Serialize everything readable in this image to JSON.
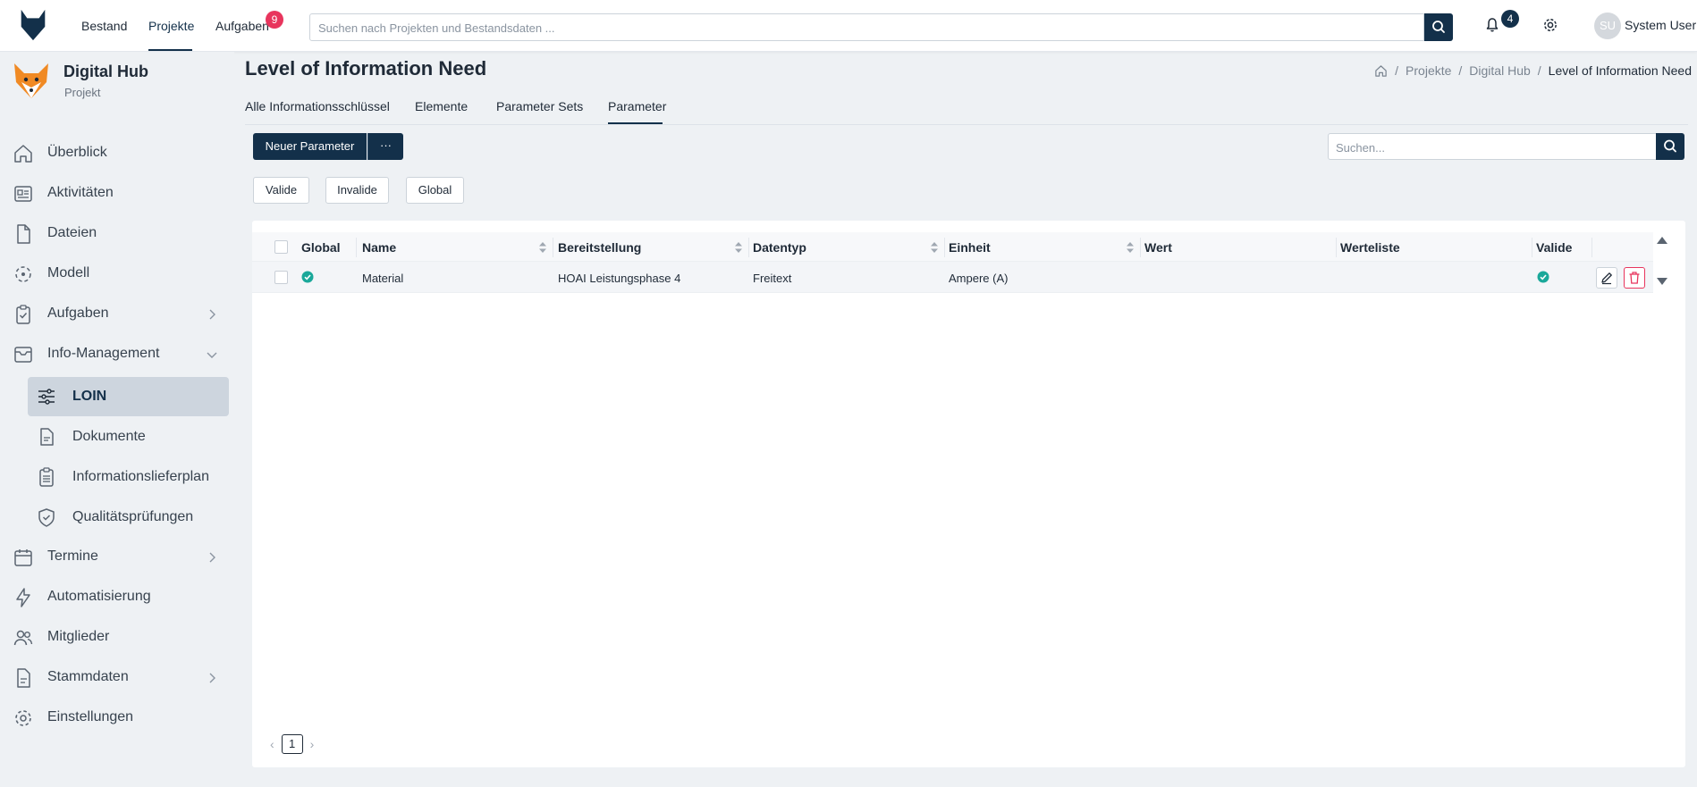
{
  "topbar": {
    "nav": [
      {
        "label": "Bestand"
      },
      {
        "label": "Projekte"
      },
      {
        "label": "Aufgaben"
      }
    ],
    "tasks_badge": "9",
    "search_placeholder": "Suchen nach Projekten und Bestandsdaten ...",
    "notifications_badge": "4",
    "user_initials": "SU",
    "user_name": "System User"
  },
  "sidebar": {
    "project_name": "Digital Hub",
    "project_type": "Projekt",
    "items": [
      {
        "label": "Überblick"
      },
      {
        "label": "Aktivitäten"
      },
      {
        "label": "Dateien"
      },
      {
        "label": "Modell"
      },
      {
        "label": "Aufgaben"
      },
      {
        "label": "Info-Management"
      },
      {
        "label": "Termine"
      },
      {
        "label": "Automatisierung"
      },
      {
        "label": "Mitglieder"
      },
      {
        "label": "Stammdaten"
      },
      {
        "label": "Einstellungen"
      }
    ],
    "sub_items": [
      {
        "label": "LOIN"
      },
      {
        "label": "Dokumente"
      },
      {
        "label": "Informationslieferplan"
      },
      {
        "label": "Qualitätsprüfungen"
      }
    ]
  },
  "page": {
    "title": "Level of Information Need",
    "breadcrumb": [
      "Projekte",
      "Digital Hub",
      "Level of Information Need"
    ],
    "tabs": [
      {
        "label": "Alle Informationsschlüssel"
      },
      {
        "label": "Elemente"
      },
      {
        "label": "Parameter Sets"
      },
      {
        "label": "Parameter"
      }
    ],
    "new_button": "Neuer Parameter",
    "more_button": "···",
    "search_placeholder": "Suchen...",
    "filters": [
      {
        "label": "Valide"
      },
      {
        "label": "Invalide"
      },
      {
        "label": "Global"
      }
    ]
  },
  "table": {
    "columns": [
      "Global",
      "Name",
      "Bereitstellung",
      "Datentyp",
      "Einheit",
      "Wert",
      "Werteliste",
      "Valide"
    ],
    "rows": [
      {
        "global": true,
        "name": "Material",
        "bereitstellung": "HOAI Leistungsphase 4",
        "datentyp": "Freitext",
        "einheit": "Ampere (A)",
        "wert": "",
        "werteliste": "",
        "valide": true
      }
    ]
  },
  "pagination": {
    "current": "1"
  },
  "colors": {
    "primary": "#13304a",
    "danger": "#e8355d",
    "success": "#1aa89a"
  }
}
